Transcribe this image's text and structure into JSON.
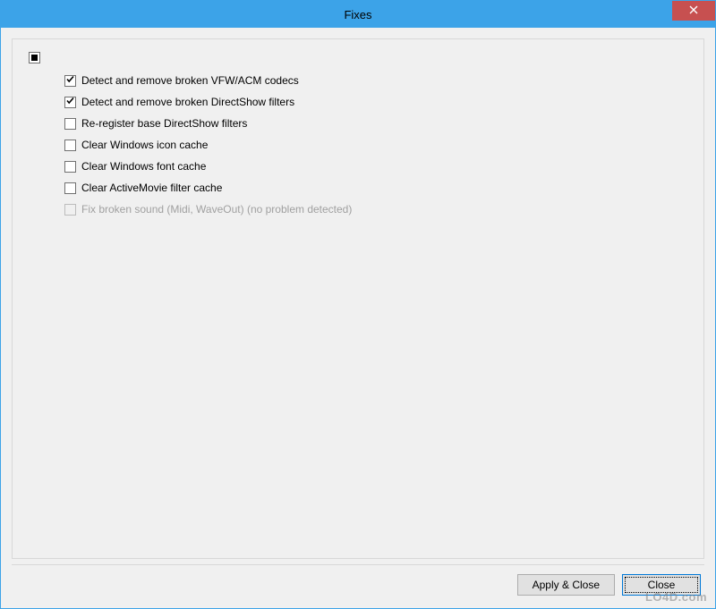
{
  "window": {
    "title": "Fixes"
  },
  "options": {
    "tristate_state": "indeterminate",
    "items": [
      {
        "label": "Detect and remove broken VFW/ACM codecs",
        "checked": true,
        "disabled": false
      },
      {
        "label": "Detect and remove broken DirectShow filters",
        "checked": true,
        "disabled": false
      },
      {
        "label": "Re-register base DirectShow filters",
        "checked": false,
        "disabled": false
      },
      {
        "label": "Clear Windows icon cache",
        "checked": false,
        "disabled": false
      },
      {
        "label": "Clear Windows font cache",
        "checked": false,
        "disabled": false
      },
      {
        "label": "Clear ActiveMovie filter cache",
        "checked": false,
        "disabled": false
      },
      {
        "label": "Fix broken sound (Midi, WaveOut)  (no problem detected)",
        "checked": false,
        "disabled": true
      }
    ]
  },
  "buttons": {
    "apply_close": "Apply & Close",
    "close": "Close"
  },
  "watermark": "LO4D.com"
}
